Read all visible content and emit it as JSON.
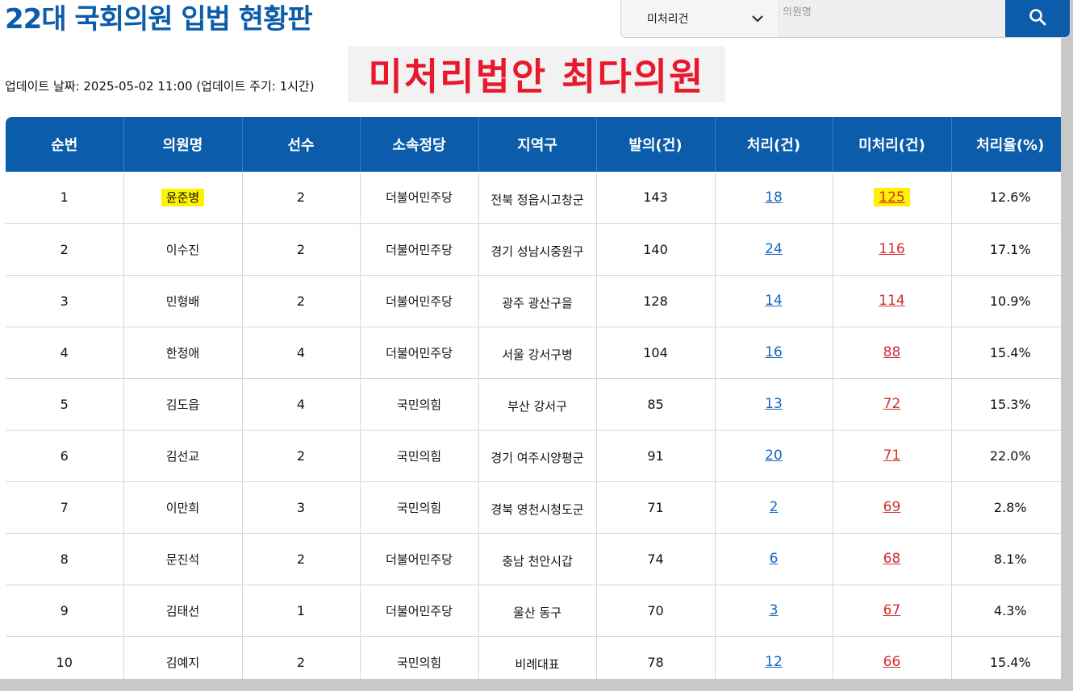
{
  "header": {
    "title": "22대 국회의원 입법 현황판",
    "update_info": "업데이트 날짜: 2025-05-02 11:00 (업데이트 주기: 1시간)",
    "banner": "미처리법안 최다의원"
  },
  "search": {
    "select_value": "미처리건",
    "placeholder": "의원명"
  },
  "table": {
    "columns": [
      "순번",
      "의원명",
      "선수",
      "소속정당",
      "지역구",
      "발의(건)",
      "처리(건)",
      "미처리(건)",
      "처리율(%)"
    ],
    "rows": [
      {
        "rank": "1",
        "name": "윤준병",
        "terms": "2",
        "party": "더불어민주당",
        "district": "전북 정읍시고창군",
        "proposed": "143",
        "processed": "18",
        "unprocessed": "125",
        "rate": "12.6%",
        "highlighted": true
      },
      {
        "rank": "2",
        "name": "이수진",
        "terms": "2",
        "party": "더불어민주당",
        "district": "경기 성남시중원구",
        "proposed": "140",
        "processed": "24",
        "unprocessed": "116",
        "rate": "17.1%"
      },
      {
        "rank": "3",
        "name": "민형배",
        "terms": "2",
        "party": "더불어민주당",
        "district": "광주 광산구을",
        "proposed": "128",
        "processed": "14",
        "unprocessed": "114",
        "rate": "10.9%"
      },
      {
        "rank": "4",
        "name": "한정애",
        "terms": "4",
        "party": "더불어민주당",
        "district": "서울 강서구병",
        "proposed": "104",
        "processed": "16",
        "unprocessed": "88",
        "rate": "15.4%"
      },
      {
        "rank": "5",
        "name": "김도읍",
        "terms": "4",
        "party": "국민의힘",
        "district": "부산 강서구",
        "proposed": "85",
        "processed": "13",
        "unprocessed": "72",
        "rate": "15.3%"
      },
      {
        "rank": "6",
        "name": "김선교",
        "terms": "2",
        "party": "국민의힘",
        "district": "경기 여주시양평군",
        "proposed": "91",
        "processed": "20",
        "unprocessed": "71",
        "rate": "22.0%"
      },
      {
        "rank": "7",
        "name": "이만희",
        "terms": "3",
        "party": "국민의힘",
        "district": "경북 영천시청도군",
        "proposed": "71",
        "processed": "2",
        "unprocessed": "69",
        "rate": "2.8%"
      },
      {
        "rank": "8",
        "name": "문진석",
        "terms": "2",
        "party": "더불어민주당",
        "district": "충남 천안시갑",
        "proposed": "74",
        "processed": "6",
        "unprocessed": "68",
        "rate": "8.1%"
      },
      {
        "rank": "9",
        "name": "김태선",
        "terms": "1",
        "party": "더불어민주당",
        "district": "울산 동구",
        "proposed": "70",
        "processed": "3",
        "unprocessed": "67",
        "rate": "4.3%"
      },
      {
        "rank": "10",
        "name": "김예지",
        "terms": "2",
        "party": "국민의힘",
        "district": "비례대표",
        "proposed": "78",
        "processed": "12",
        "unprocessed": "66",
        "rate": "15.4%"
      }
    ]
  },
  "colors": {
    "brand_blue": "#0b5cab",
    "banner_red": "#e8192c",
    "link_blue": "#1565c0",
    "link_red": "#d32f2f",
    "highlight_yellow": "#fff200"
  },
  "icons": {
    "select_arrow": "chevron-down-icon",
    "search_button": "search-icon"
  }
}
